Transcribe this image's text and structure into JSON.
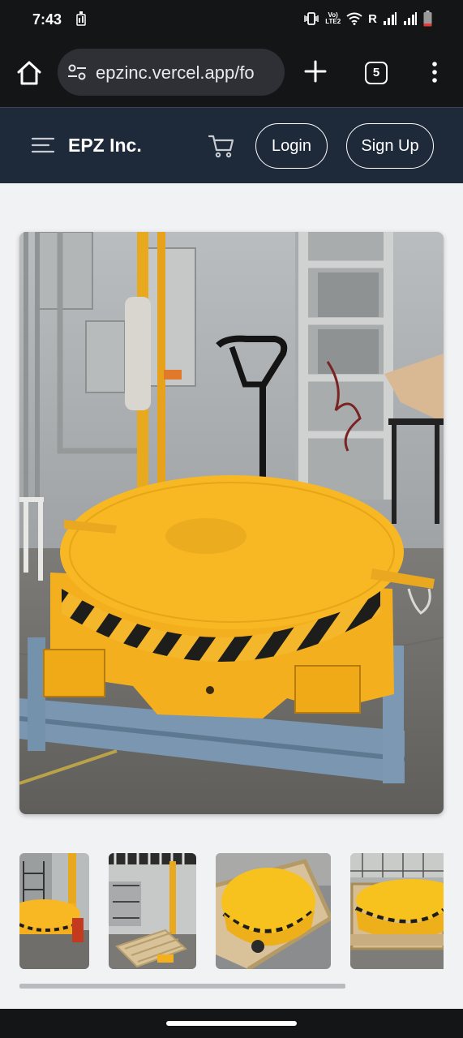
{
  "status_bar": {
    "time": "7:43",
    "volte_line1": "Vo)",
    "volte_line2": "LTE2",
    "roaming": "R",
    "icons": [
      "sim-icon",
      "vibrate-icon",
      "volte-icon",
      "wifi-icon",
      "signal-icon",
      "signal-icon",
      "battery-icon"
    ],
    "battery_level": 0.15
  },
  "browser": {
    "url": "epzinc.vercel.app/fo",
    "tab_count": "5",
    "icons": [
      "home-icon",
      "site-settings-icon",
      "new-tab-icon",
      "tab-switcher-icon",
      "more-menu-icon"
    ]
  },
  "header": {
    "brand": "EPZ Inc.",
    "login_label": "Login",
    "signup_label": "Sign Up",
    "icons": [
      "hamburger-icon",
      "cart-icon"
    ]
  },
  "gallery": {
    "main_image": "yellow-turntable-pallet-wrapper-photo",
    "thumbnails": [
      "turntable-in-warehouse-photo",
      "wrapper-mast-with-pallet-photo",
      "turntable-in-crate-photo",
      "turntable-crated-side-photo"
    ],
    "scroll_position": 0.0
  },
  "colors": {
    "status_bar_bg": "#141517",
    "header_bg": "#1e2939",
    "page_bg": "#f1f2f4",
    "turntable_yellow": "#f5b323"
  }
}
